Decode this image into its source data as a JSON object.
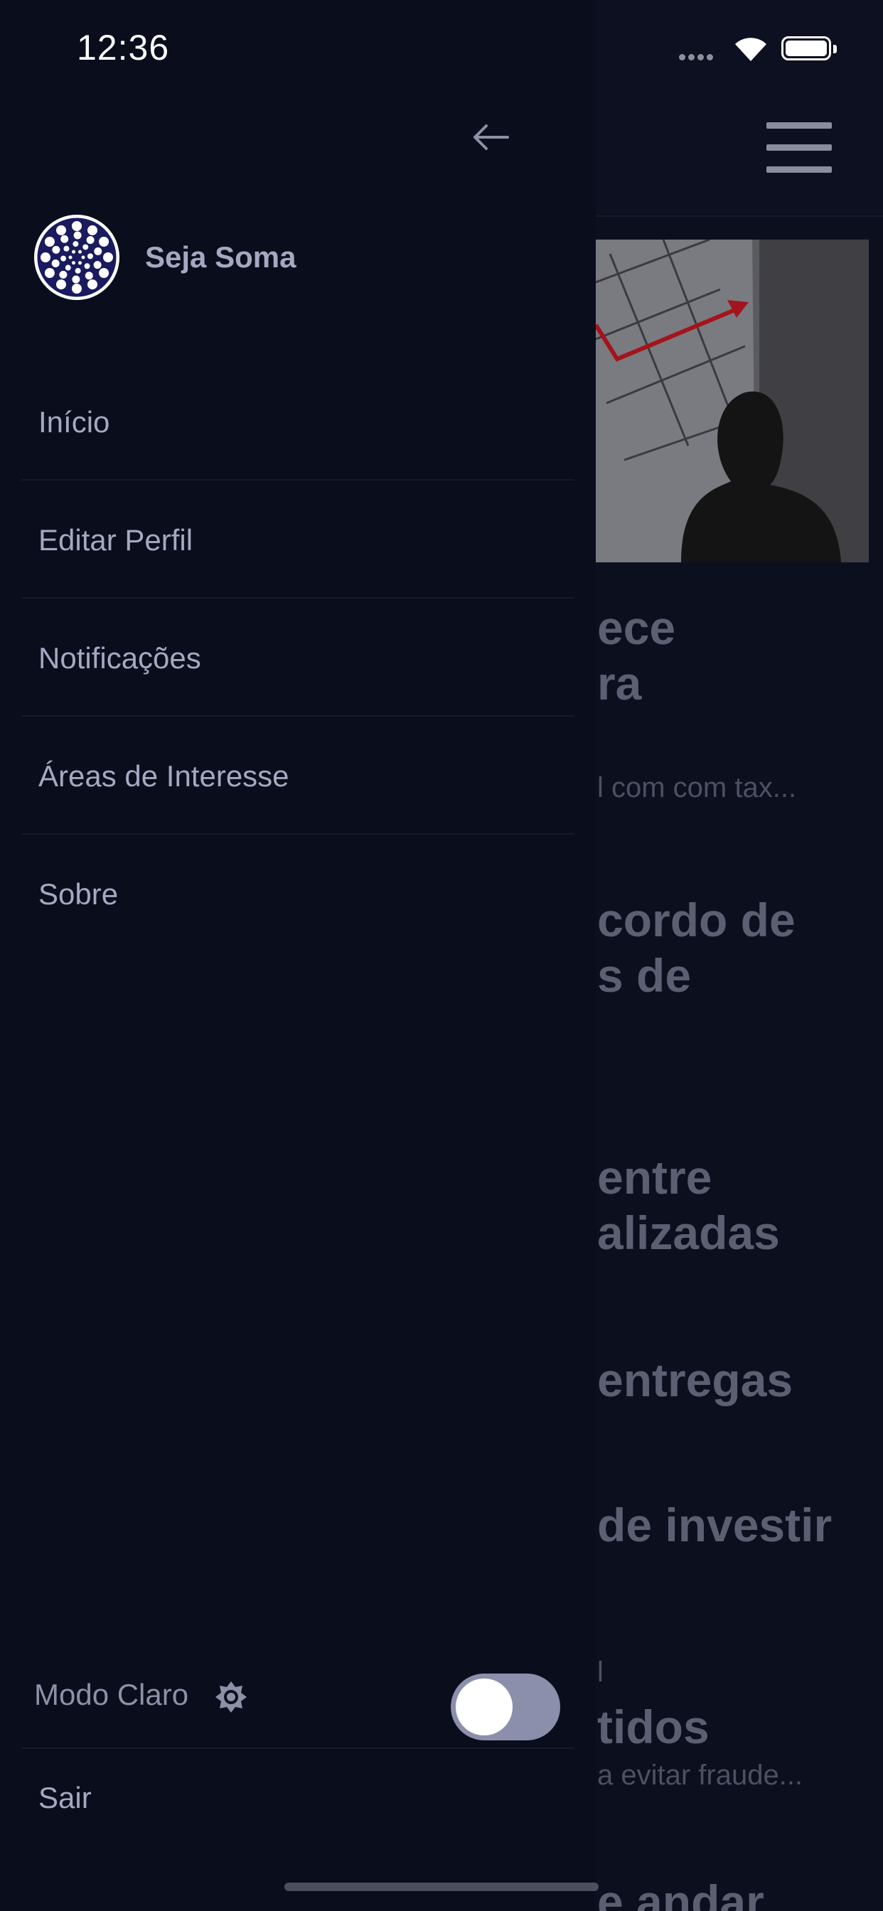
{
  "status_bar": {
    "time": "12:36"
  },
  "drawer": {
    "profile_name": "Seja Soma",
    "menu_items": [
      {
        "label": "Início"
      },
      {
        "label": "Editar Perfil"
      },
      {
        "label": "Notificações"
      },
      {
        "label": "Áreas de Interesse"
      },
      {
        "label": "Sobre"
      }
    ],
    "mode_label": "Modo Claro",
    "mode_toggle_on": false,
    "logout_label": "Sair"
  },
  "background_feed": {
    "snippets": [
      "ece",
      "ra",
      "l com com tax...",
      "cordo de",
      "s de",
      "entre",
      "alizadas",
      "entregas",
      "de investir",
      "l",
      "tidos",
      "a evitar fraude...",
      "e andar"
    ]
  },
  "colors": {
    "drawer_bg": "#0a0d1b",
    "menu_text": "#a6a8c2",
    "toggle_track": "#8c8fac"
  }
}
